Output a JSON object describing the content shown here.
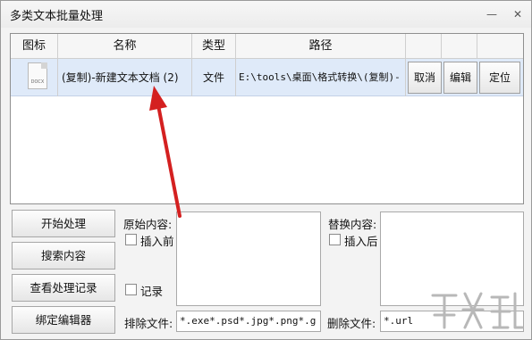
{
  "window": {
    "title": "多类文本批量处理",
    "minimize_icon": "minimize-icon",
    "close_icon": "close-icon"
  },
  "table": {
    "headers": [
      "图标",
      "名称",
      "类型",
      "路径"
    ],
    "rows": [
      {
        "icon": "docx-file-icon",
        "icon_label": "DOCX",
        "name": "(复制)-新建文本文档 (2)",
        "type": "文件",
        "path": "E:\\tools\\桌面\\格式转换\\(复制)-",
        "actions": [
          "取消",
          "编辑",
          "定位"
        ]
      }
    ]
  },
  "buttons": {
    "start": "开始处理",
    "search": "搜索内容",
    "view_log": "查看处理记录",
    "bind_editor": "绑定编辑器"
  },
  "original": {
    "label": "原始内容:",
    "insert_before": "插入前",
    "record": "记录",
    "value": ""
  },
  "replace": {
    "label": "替换内容:",
    "insert_after": "插入后",
    "value": ""
  },
  "exclude": {
    "label": "排除文件:",
    "value": "*.exe*.psd*.jpg*.png*.g"
  },
  "delete": {
    "label": "删除文件:",
    "value": "*.url"
  },
  "annotation": {
    "arrow_color": "#d42020"
  },
  "watermark": {
    "icon": "watermark-logo"
  }
}
